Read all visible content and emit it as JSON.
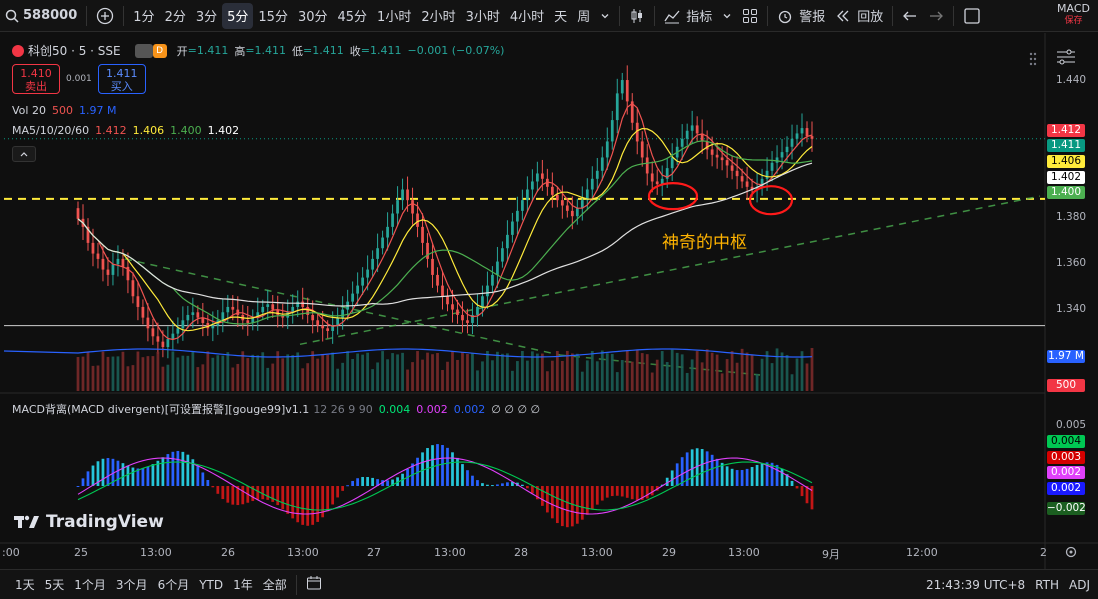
{
  "toolbar": {
    "symbol": "588000",
    "intervals": [
      "1分",
      "2分",
      "3分",
      "5分",
      "15分",
      "30分",
      "45分",
      "1小时",
      "2小时",
      "3小时",
      "4小时",
      "天",
      "周"
    ],
    "active_interval": "5分",
    "indicators_label": "指标",
    "alert_label": "警报",
    "replay_label": "回放",
    "layout_name": "MACD",
    "save_label": "保存"
  },
  "legend": {
    "title": "科创50 · 5 · SSE",
    "open_label": "开",
    "open": "=1.411",
    "high_label": "高",
    "high": "=1.411",
    "low_label": "低",
    "low": "=1.411",
    "close_label": "收",
    "close": "=1.411",
    "change": "−0.001 (−0.07%)",
    "sell_price": "1.410",
    "sell_label": "卖出",
    "spread": "0.001",
    "buy_price": "1.411",
    "buy_label": "买入",
    "vol_label": "Vol 20",
    "vol_val1": "500",
    "vol_val2": "1.97 M",
    "ma_label": "MA5/10/20/60",
    "ma5": "1.412",
    "ma10": "1.406",
    "ma20": "1.400",
    "ma60": "1.402",
    "macd_label": "MACD背离(MACD divergent)[可设置报警][gouge99]v1.1",
    "macd_params": "12 26 9 90",
    "macd_v1": "0.004",
    "macd_v2": "0.002",
    "macd_v3": "0.002",
    "macd_zeros": "∅ ∅ ∅ ∅"
  },
  "annotation": "神奇的中枢",
  "price_axis": [
    "1.440",
    "1.420",
    "1.400",
    "1.380",
    "1.360",
    "1.340"
  ],
  "price_tags": {
    "t1": "1.412",
    "t2": "1.411",
    "t3": "1.406",
    "t4": "1.402",
    "t5": "1.400",
    "vol1": "1.97 M",
    "vol2": "500",
    "m_axis": "0.005",
    "m1": "0.004",
    "m2": "0.003",
    "m3": "0.002",
    "m4": "0.002",
    "m5": "−0.002"
  },
  "time_axis": [
    ":00",
    "25",
    "13:00",
    "26",
    "13:00",
    "27",
    "13:00",
    "28",
    "13:00",
    "29",
    "13:00",
    "9月",
    "12:00",
    "2"
  ],
  "bottombar": {
    "ranges": [
      "1天",
      "5天",
      "1个月",
      "3个月",
      "6个月",
      "YTD",
      "1年",
      "全部"
    ],
    "clock": "21:43:39 UTC+8",
    "rth": "RTH",
    "adj": "ADJ"
  },
  "brand": "TradingView",
  "colors": {
    "up": "#26a69a",
    "down": "#ef5350",
    "ma5": "#ef5350",
    "ma10": "#ffeb3b",
    "ma20": "#4caf50",
    "ma60": "#e0e0e0",
    "dashed_level": "#ffeb3b",
    "trend": "#4caf50",
    "circle": "#ff1a1a"
  },
  "chart_data": {
    "type": "candlestick",
    "price_ylim": [
      1.33,
      1.445
    ],
    "closes": [
      1.381,
      1.378,
      1.372,
      1.368,
      1.366,
      1.362,
      1.36,
      1.364,
      1.366,
      1.363,
      1.358,
      1.352,
      1.348,
      1.344,
      1.34,
      1.337,
      1.335,
      1.333,
      1.336,
      1.338,
      1.34,
      1.343,
      1.345,
      1.346,
      1.344,
      1.342,
      1.34,
      1.341,
      1.343,
      1.346,
      1.348,
      1.347,
      1.345,
      1.343,
      1.342,
      1.344,
      1.346,
      1.348,
      1.349,
      1.347,
      1.345,
      1.344,
      1.346,
      1.348,
      1.35,
      1.348,
      1.345,
      1.343,
      1.341,
      1.34,
      1.339,
      1.341,
      1.344,
      1.347,
      1.35,
      1.353,
      1.356,
      1.359,
      1.362,
      1.366,
      1.37,
      1.374,
      1.378,
      1.383,
      1.388,
      1.392,
      1.388,
      1.383,
      1.378,
      1.372,
      1.366,
      1.36,
      1.356,
      1.352,
      1.349,
      1.347,
      1.345,
      1.343,
      1.342,
      1.345,
      1.348,
      1.352,
      1.356,
      1.36,
      1.365,
      1.37,
      1.375,
      1.38,
      1.384,
      1.388,
      1.392,
      1.395,
      1.398,
      1.396,
      1.393,
      1.39,
      1.388,
      1.386,
      1.384,
      1.382,
      1.385,
      1.388,
      1.392,
      1.396,
      1.399,
      1.404,
      1.41,
      1.418,
      1.428,
      1.433,
      1.425,
      1.417,
      1.41,
      1.404,
      1.398,
      1.395,
      1.394,
      1.396,
      1.4,
      1.404,
      1.408,
      1.411,
      1.414,
      1.416,
      1.413,
      1.41,
      1.407,
      1.405,
      1.404,
      1.403,
      1.401,
      1.399,
      1.397,
      1.395,
      1.393,
      1.392,
      1.393,
      1.396,
      1.399,
      1.402,
      1.404,
      1.406,
      1.408,
      1.411,
      1.413,
      1.415,
      1.412,
      1.411
    ]
  }
}
